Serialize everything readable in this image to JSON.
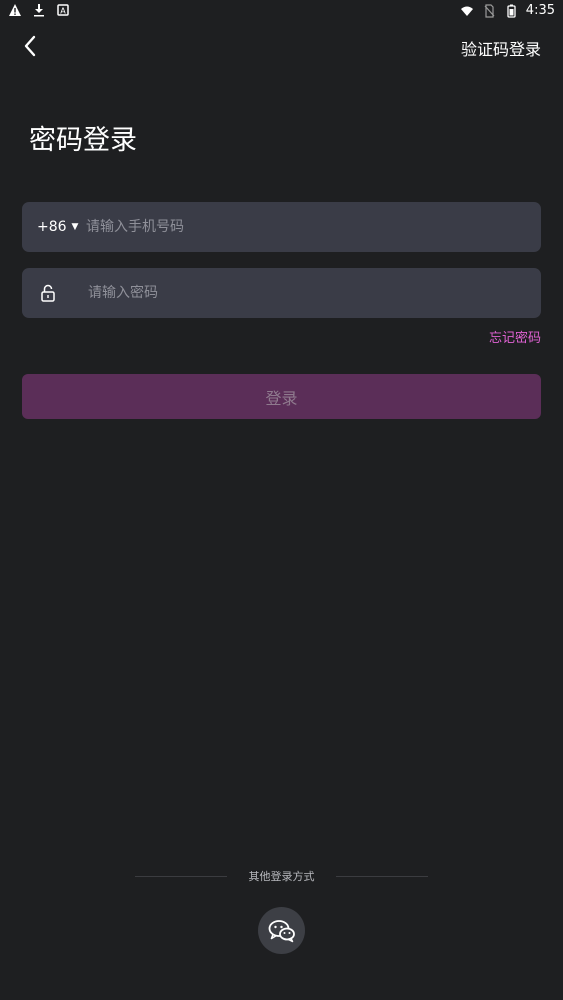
{
  "status_bar": {
    "time": "4:35",
    "left_icons": [
      "warning-icon",
      "download-icon",
      "app-notification-icon"
    ],
    "right_icons": [
      "wifi-icon",
      "no-sim-icon",
      "battery-icon"
    ]
  },
  "header": {
    "back_icon": "chevron-left-icon",
    "switch_label": "验证码登录"
  },
  "page": {
    "title": "密码登录"
  },
  "phone_field": {
    "country_code": "+86",
    "placeholder": "请输入手机号码",
    "value": ""
  },
  "password_field": {
    "icon": "lock-icon",
    "placeholder": "请输入密码",
    "value": ""
  },
  "forgot_label": "忘记密码",
  "login_label": "登录",
  "other_login": {
    "label": "其他登录方式",
    "methods": [
      "wechat-icon"
    ]
  },
  "colors": {
    "background": "#1e1f21",
    "field": "#3a3c47",
    "accent": "#e062d4",
    "login_button": "#5b2e58"
  }
}
